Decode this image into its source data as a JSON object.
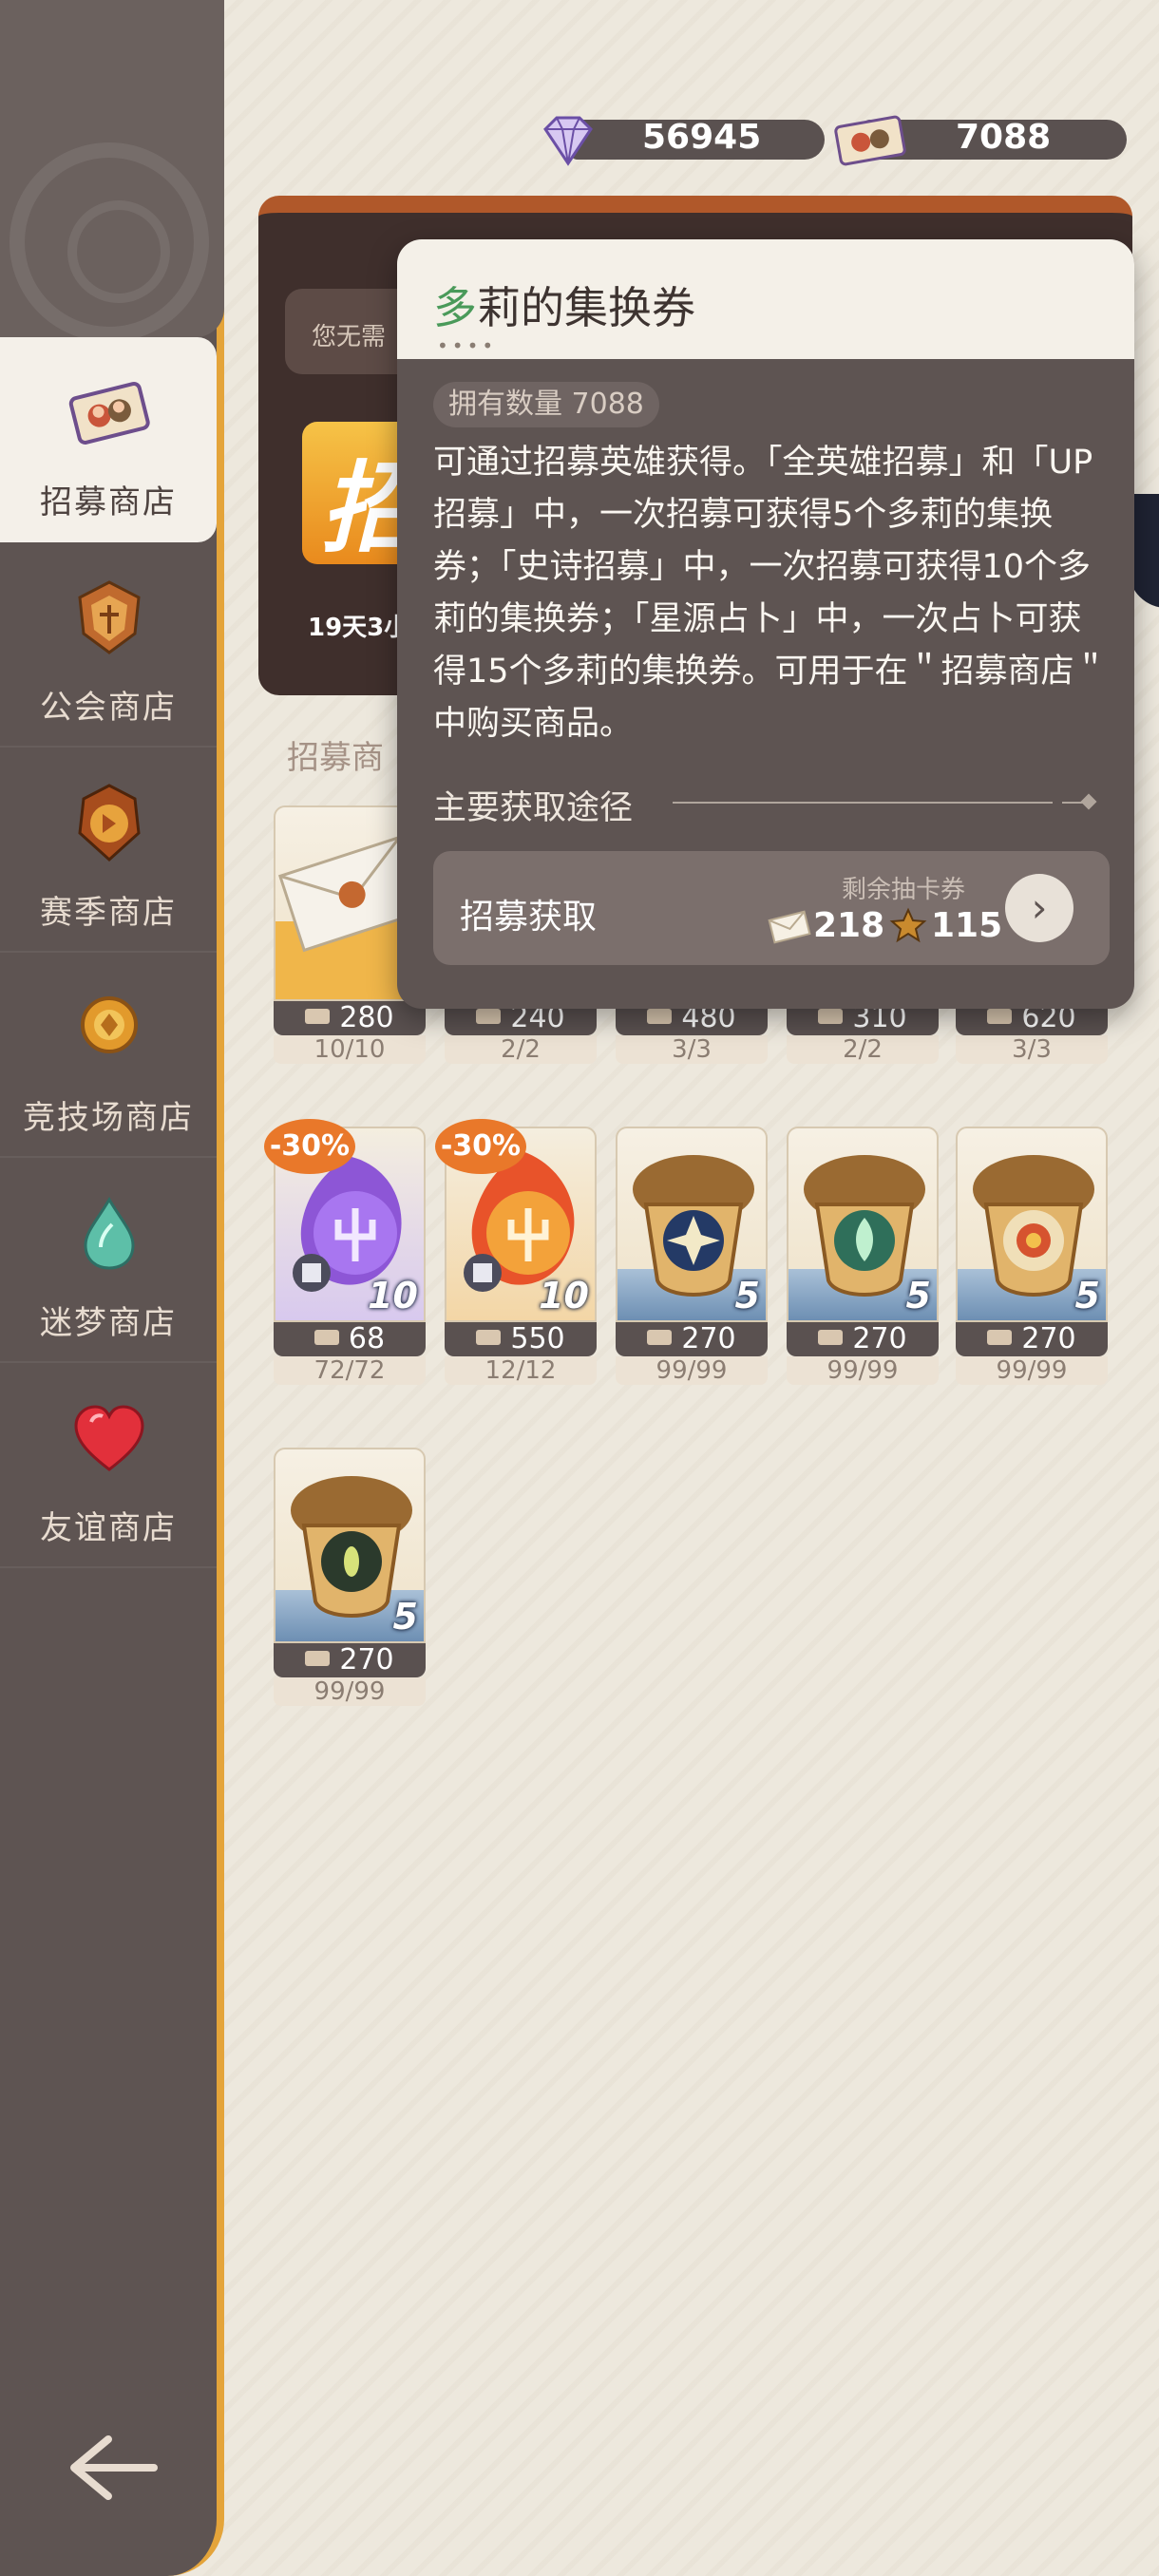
{
  "currencies": {
    "diamonds": "56945",
    "tickets": "7088"
  },
  "sidebar": {
    "items": [
      {
        "label": "招募商店",
        "icon": "ticket-icon",
        "active": true
      },
      {
        "label": "公会商店",
        "icon": "guild-badge-icon"
      },
      {
        "label": "赛季商店",
        "icon": "season-badge-icon"
      },
      {
        "label": "竞技场商店",
        "icon": "arena-coin-icon"
      },
      {
        "label": "迷梦商店",
        "icon": "dream-drop-icon"
      },
      {
        "label": "友谊商店",
        "icon": "heart-icon"
      }
    ]
  },
  "banner": {
    "note": "您无需",
    "logo_char": "招",
    "time": "19天3小"
  },
  "section_title": "招募商",
  "items_row1": [
    {
      "price": "280",
      "stock": "10/10"
    },
    {
      "price": "240",
      "stock": "2/2"
    },
    {
      "price": "480",
      "stock": "3/3"
    },
    {
      "price": "310",
      "stock": "2/2"
    },
    {
      "price": "620",
      "stock": "3/3"
    }
  ],
  "items_row2": [
    {
      "price": "68",
      "stock": "72/72",
      "count": "10",
      "discount": "-30%"
    },
    {
      "price": "550",
      "stock": "12/12",
      "count": "10",
      "discount": "-30%"
    },
    {
      "price": "270",
      "stock": "99/99",
      "count": "5"
    },
    {
      "price": "270",
      "stock": "99/99",
      "count": "5"
    },
    {
      "price": "270",
      "stock": "99/99",
      "count": "5"
    }
  ],
  "items_row3": [
    {
      "price": "270",
      "stock": "99/99",
      "count": "5"
    }
  ],
  "popup": {
    "title_first": "多",
    "title_rest": "莉的集换券",
    "dots": "••••",
    "owned": "拥有数量 7088",
    "description": "可通过招募英雄获得。「全英雄招募」和「UP招募」中，一次招募可获得5个多莉的集换券；「史诗招募」中，一次招募可获得10个多莉的集换券；「星源占卜」中，一次占卜可获得15个多莉的集换券。可用于在＂招募商店＂中购买商品。",
    "sources_title": "主要获取途径",
    "source": {
      "label": "招募获取",
      "remain_label": "剩余抽卡券",
      "count_a": "218",
      "count_b": "115"
    }
  },
  "colors": {
    "sidebar": "#5e5452",
    "accent_orange": "#e4a43a",
    "popup_body": "#5e5452",
    "popup_head": "#f4f0e8",
    "discount": "#e9782a"
  }
}
